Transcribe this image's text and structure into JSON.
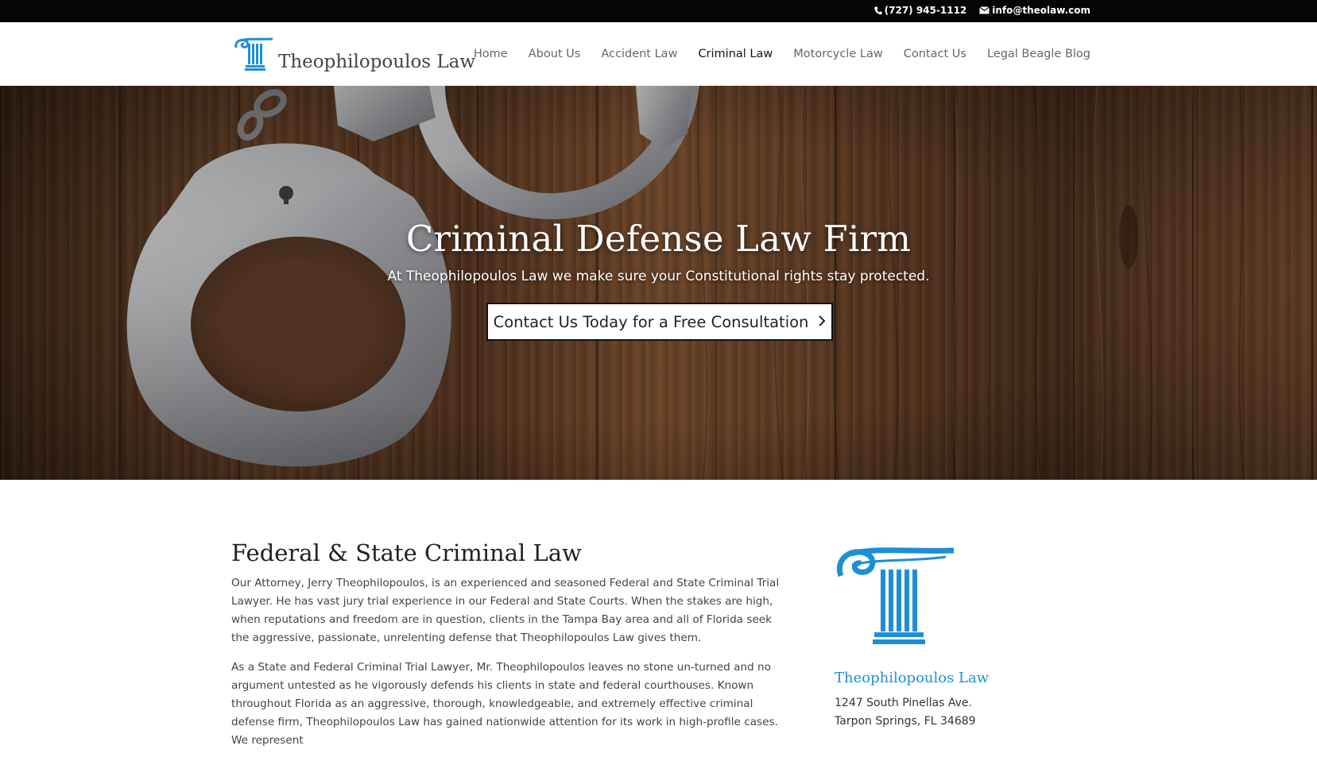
{
  "topbar": {
    "phone": "(727) 945-1112",
    "email": "info@theolaw.com"
  },
  "header": {
    "logo_text": "Theophilopoulos Law",
    "nav": [
      {
        "label": "Home",
        "active": false
      },
      {
        "label": "About Us",
        "active": false
      },
      {
        "label": "Accident Law",
        "active": false
      },
      {
        "label": "Criminal Law",
        "active": true
      },
      {
        "label": "Motorcycle Law",
        "active": false
      },
      {
        "label": "Contact Us",
        "active": false
      },
      {
        "label": "Legal Beagle Blog",
        "active": false
      }
    ]
  },
  "hero": {
    "title": "Criminal Defense Law Firm",
    "subtitle": "At Theophilopoulos Law we make sure your Constitutional rights stay protected.",
    "cta_label": "Contact Us Today for a Free Consultation"
  },
  "main": {
    "heading": "Federal & State Criminal Law",
    "paragraphs": [
      "Our Attorney, Jerry Theophilopoulos, is an experienced and seasoned Federal and State Criminal Trial Lawyer. He has vast jury trial experience in our Federal and State Courts. When the stakes are high, when reputations and freedom are in question, clients in the Tampa Bay area and all of Florida seek the aggressive, passionate, unrelenting defense that Theophilopoulos Law gives them.",
      "As a State and Federal Criminal Trial Lawyer, Mr. Theophilopoulos leaves no stone un-turned and no argument untested as he vigorously defends his clients in state and federal courthouses. Known throughout Florida as an aggressive, thorough, knowledgeable, and extremely effective criminal defense firm, Theophilopoulos Law has gained nationwide attention for its work in high-profile cases. We represent"
    ]
  },
  "sidebar": {
    "firm_name": "Theophilopoulos Law",
    "address_line1": "1247 South Pinellas Ave.",
    "address_line2": "Tarpon Springs, FL 34689"
  },
  "colors": {
    "brand_blue": "#1e8fd6",
    "topbar_bg": "#050505"
  },
  "icons": [
    "phone-icon",
    "mail-icon",
    "column-logo-icon",
    "chevron-right-icon"
  ]
}
